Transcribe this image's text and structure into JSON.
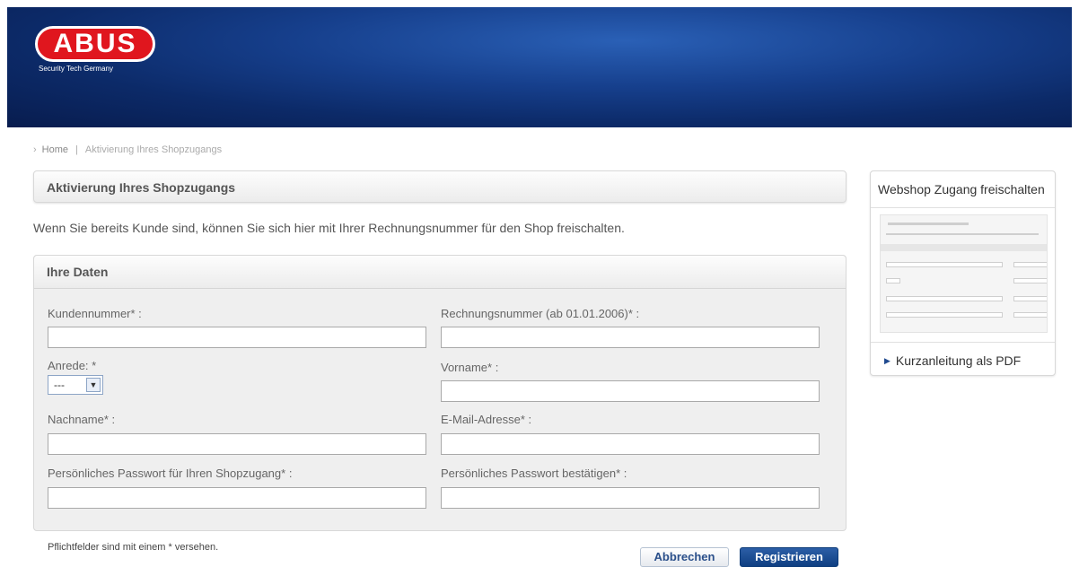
{
  "brand": {
    "name": "ABUS",
    "tagline": "Security Tech Germany"
  },
  "breadcrumb": {
    "home": "Home",
    "separator": "|",
    "current": "Aktivierung Ihres Shopzugangs"
  },
  "page_title": "Aktivierung Ihres Shopzugangs",
  "intro": "Wenn Sie bereits Kunde sind, können Sie sich hier mit Ihrer Rechnungsnummer für den Shop freischalten.",
  "form": {
    "section_title": "Ihre Daten",
    "fields": {
      "kundennummer": "Kundennummer* :",
      "rechnungsnummer": "Rechnungsnummer (ab 01.01.2006)* :",
      "anrede": "Anrede: *",
      "anrede_value": "---",
      "vorname": "Vorname* :",
      "nachname": "Nachname* :",
      "email": "E-Mail-Adresse* :",
      "passwort": "Persönliches Passwort für Ihren Shopzugang* :",
      "passwort_confirm": "Persönliches Passwort bestätigen* :"
    },
    "required_note": "Pflichtfelder sind mit einem * versehen.",
    "cancel_label": "Abbrechen",
    "submit_label": "Registrieren"
  },
  "sidebar": {
    "title": "Webshop Zugang freischalten",
    "pdf_link": "Kurzanleitung als PDF"
  },
  "colors": {
    "brand_red": "#e0161e",
    "header_blue": "#163f8c",
    "button_blue": "#0f3f82"
  }
}
